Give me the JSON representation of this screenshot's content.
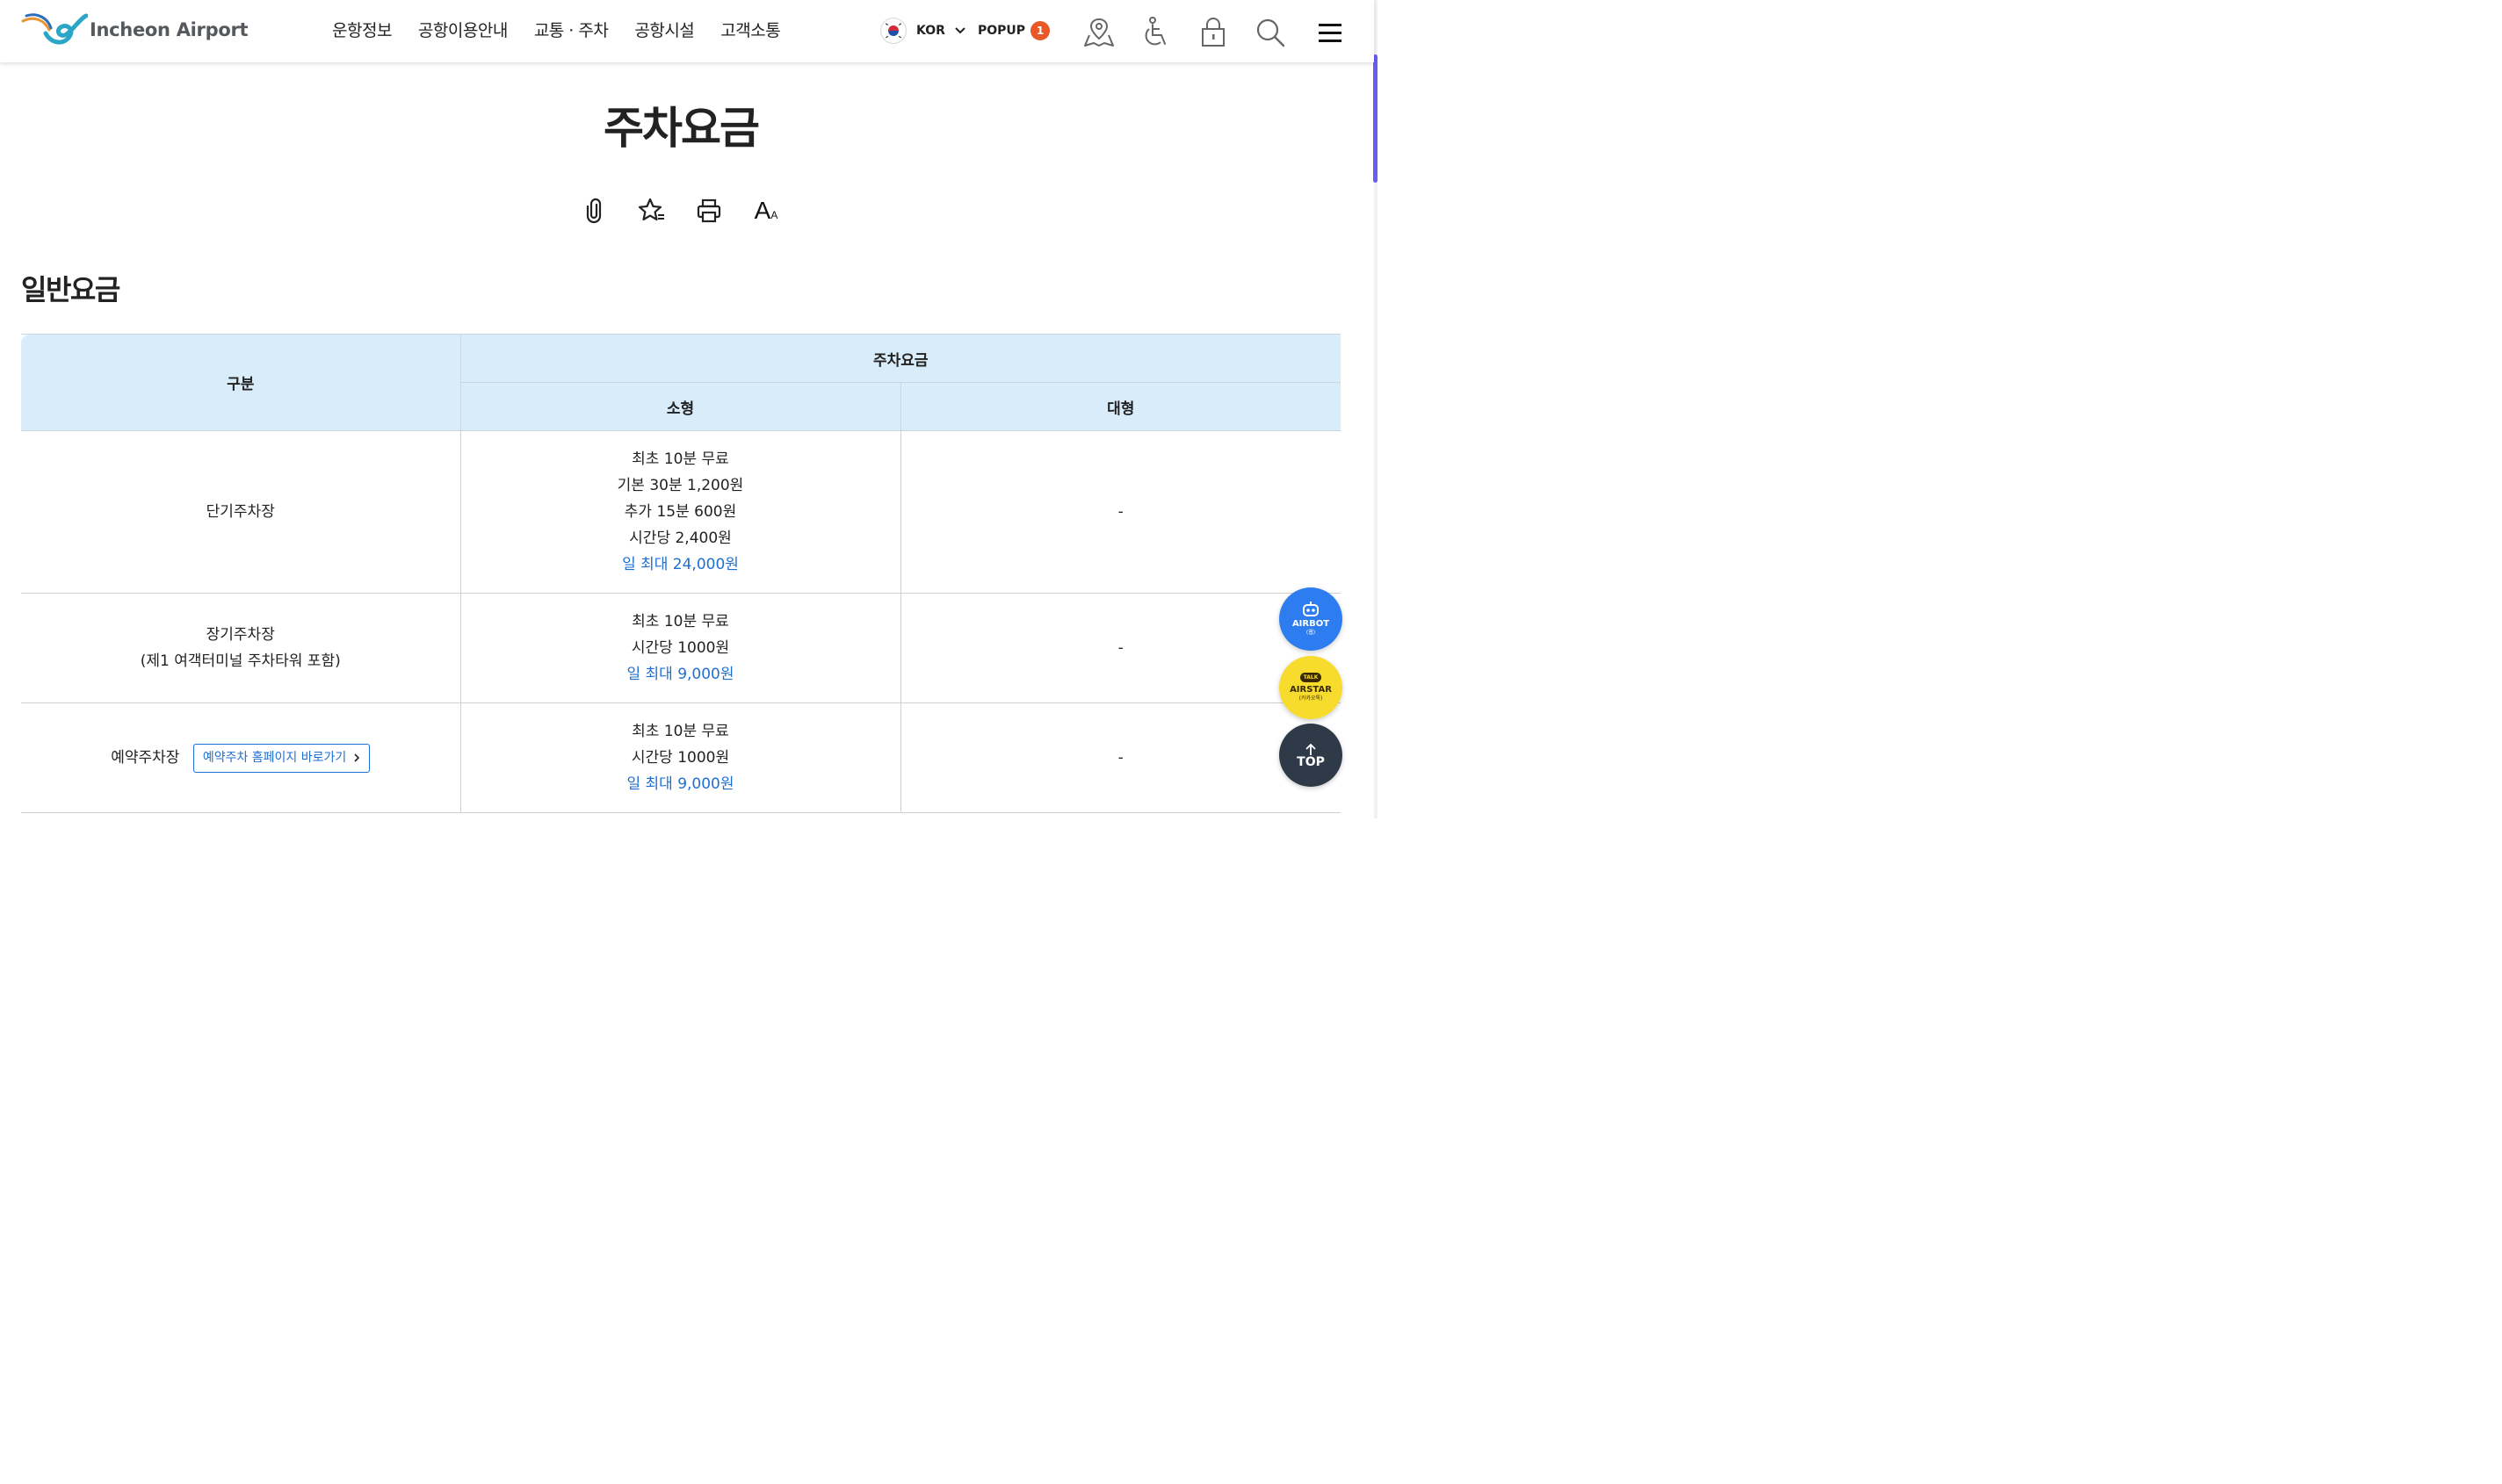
{
  "header": {
    "logo_text": "Incheon Airport",
    "nav": [
      "운항정보",
      "공항이용안내",
      "교통 · 주차",
      "공항시설",
      "고객소통"
    ],
    "lang_label": "KOR",
    "popup_label": "POPUP",
    "popup_count": "1"
  },
  "page": {
    "title": "주차요금",
    "section_title": "일반요금"
  },
  "table": {
    "headers": {
      "category": "구분",
      "fee": "주차요금",
      "small": "소형",
      "large": "대형"
    },
    "rows": [
      {
        "name_line1": "단기주차장",
        "small_lines": [
          "최초 10분 무료",
          "기본 30분 1,200원",
          "추가 15분 600원",
          "시간당 2,400원"
        ],
        "small_max": "일 최대 24,000원",
        "large": "-"
      },
      {
        "name_line1": "장기주차장",
        "name_line2": "(제1 여객터미널 주차타워 포함)",
        "small_lines": [
          "최초 10분 무료",
          "시간당 1000원"
        ],
        "small_max": "일 최대 9,000원",
        "large": "-"
      },
      {
        "name_line1": "예약주차장",
        "link_label": "예약주차 홈페이지 바로가기",
        "small_lines": [
          "최초 10분 무료",
          "시간당 1000원"
        ],
        "small_max": "일 최대 9,000원",
        "large": "-"
      }
    ]
  },
  "floating": {
    "airbot_label": "AIRBOT",
    "airbot_sub": "(웹)",
    "airstar_badge": "TALK",
    "airstar_label": "AIRSTAR",
    "airstar_sub": "(카카오톡)",
    "top_label": "TOP"
  },
  "colors": {
    "accent_blue": "#1f6fd3",
    "table_header_bg": "#d9ecf9",
    "popup_badge": "#e8592a",
    "airbot_bg": "#2e7df0",
    "airstar_bg": "#f7dc2e",
    "top_bg": "#2f3a48"
  },
  "icons": [
    "map-pin-icon",
    "accessibility-icon",
    "lock-icon",
    "search-icon",
    "menu-icon",
    "attachment-icon",
    "star-icon",
    "print-icon",
    "font-size-icon",
    "chevron-down-icon",
    "chevron-right-icon",
    "arrow-up-icon"
  ]
}
